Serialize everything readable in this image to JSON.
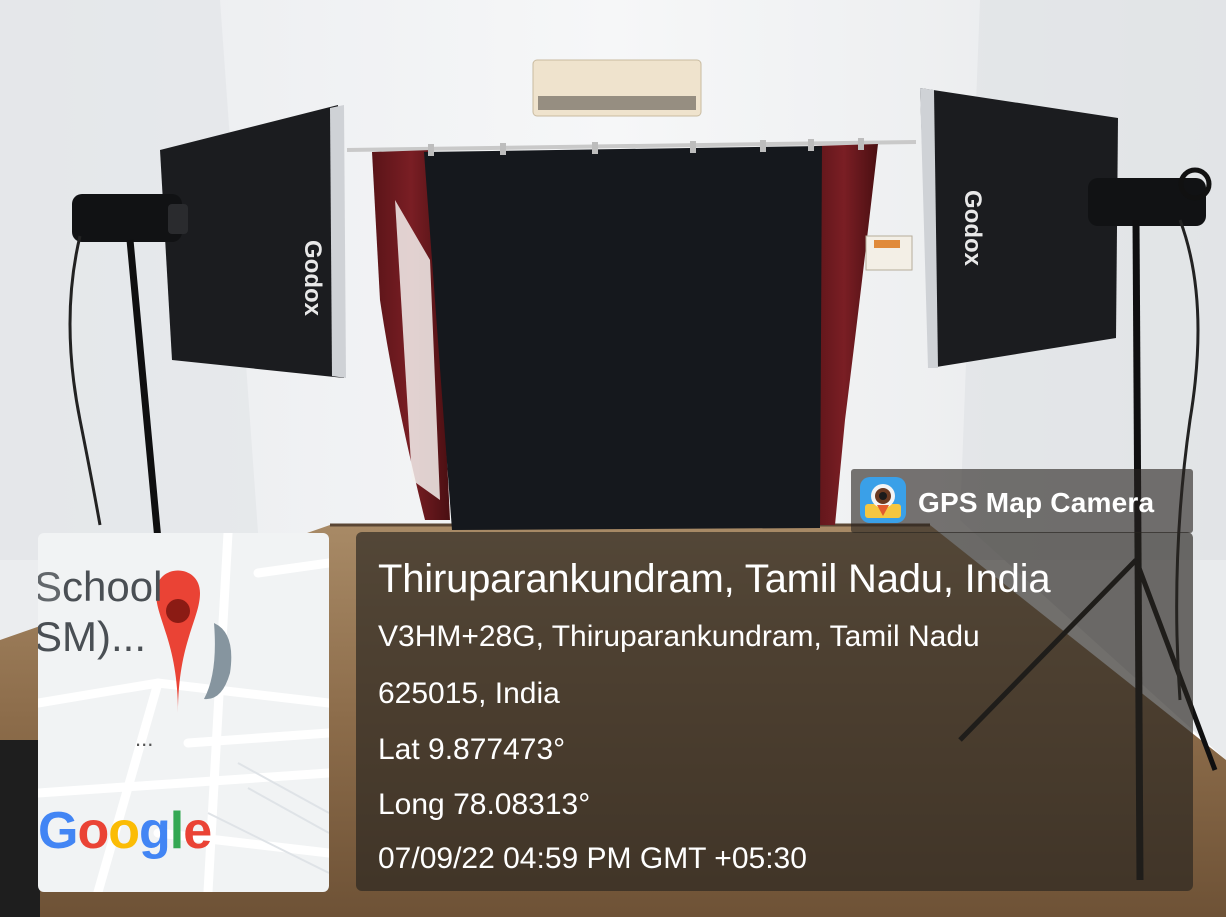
{
  "overlay": {
    "app_name": "GPS Map Camera",
    "place_title": "Thiruparankundram, Tamil Nadu, India",
    "address_line1": "V3HM+28G, Thiruparankundram, Tamil Nadu",
    "address_line2": "625015, India",
    "latitude": "Lat 9.877473°",
    "longitude": "Long 78.08313°",
    "datetime": "07/09/22 04:59 PM GMT +05:30"
  },
  "map": {
    "label_line1": "chool",
    "label_line1_prefix": "S",
    "label_line2": "SM)...",
    "more_dots": "...",
    "logo_letters": [
      "G",
      "o",
      "o",
      "g",
      "l",
      "e"
    ],
    "logo_colors": [
      "#4285F4",
      "#EA4335",
      "#FBBC05",
      "#4285F4",
      "#34A853",
      "#EA4335"
    ]
  },
  "softbox": {
    "brand_left": "Godox",
    "brand_right": "Godox"
  }
}
